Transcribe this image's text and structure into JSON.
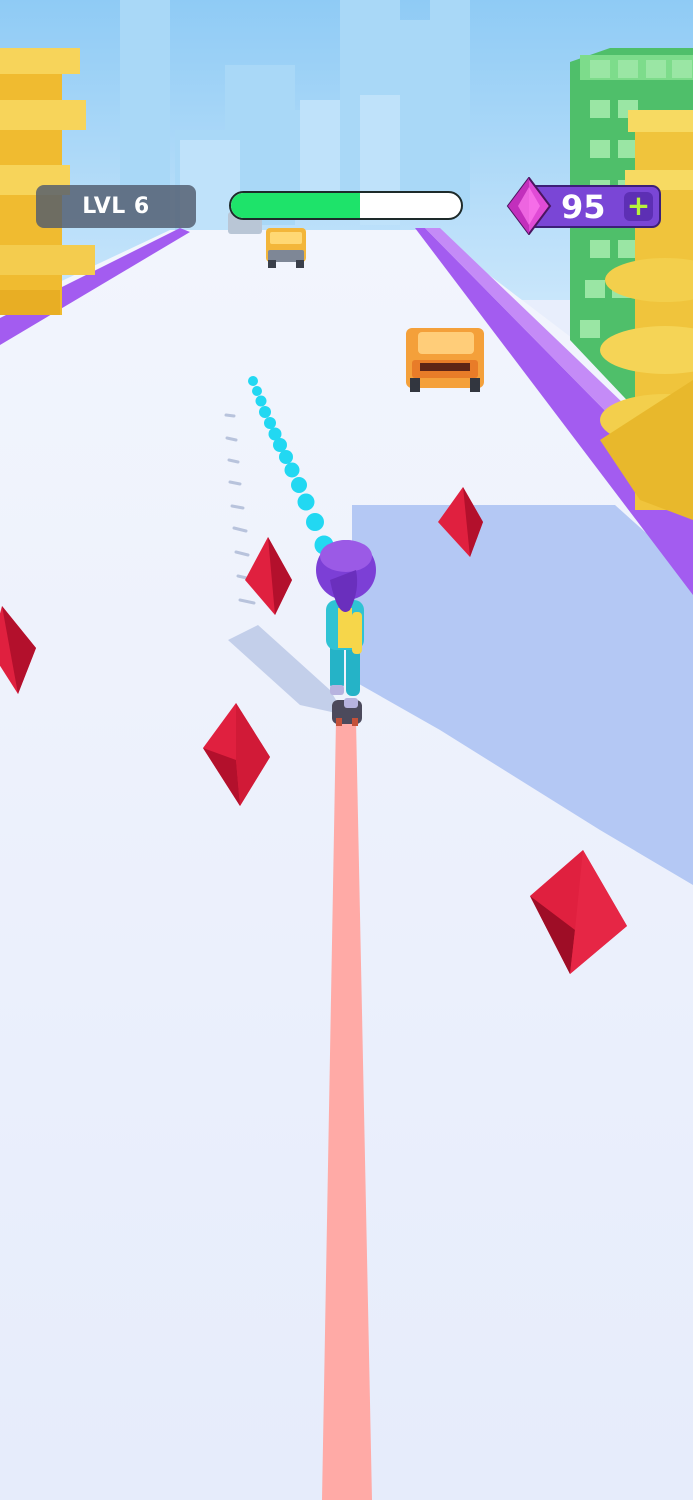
{
  "hud": {
    "level_label": "LVL 6",
    "progress_fraction": 0.56,
    "gem_count": "95",
    "gem_plus": "+"
  },
  "colors": {
    "sky": "#8fcbf5",
    "road": "#e8eefc",
    "rail": "#a35cf0",
    "trail": "#ffaaa6",
    "crystal": "#e0203f",
    "progress_fill": "#1ee36a",
    "gem_panel": "#7a46d6",
    "plus_sign": "#b8f23c"
  },
  "icons": {
    "currency": "purple-gem-icon",
    "add": "plus-icon"
  }
}
